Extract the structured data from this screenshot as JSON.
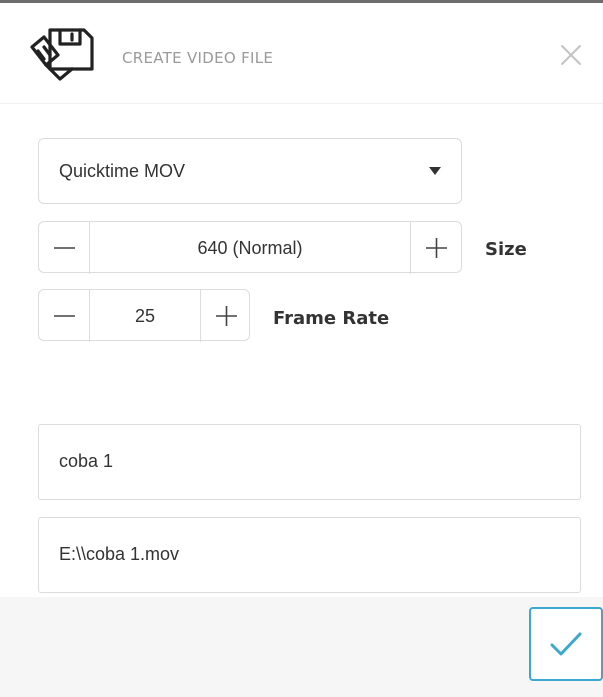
{
  "dialog": {
    "title": "CREATE VIDEO FILE",
    "icon": "save-video-icon",
    "close_icon": "close-icon"
  },
  "format_select": {
    "selected": "Quicktime MOV"
  },
  "size_stepper": {
    "value": "640 (Normal)",
    "label": "Size"
  },
  "frame_rate_stepper": {
    "value": "25",
    "label": "Frame Rate"
  },
  "file_name": {
    "value": "coba 1"
  },
  "file_path": {
    "value": "E:\\\\coba 1.mov"
  },
  "footer": {
    "confirm_icon": "checkmark-icon"
  },
  "colors": {
    "accent": "#3da8cf",
    "title_text": "#9a9a9a",
    "border": "#dcdcdc",
    "footer_bg": "#f6f6f6"
  }
}
